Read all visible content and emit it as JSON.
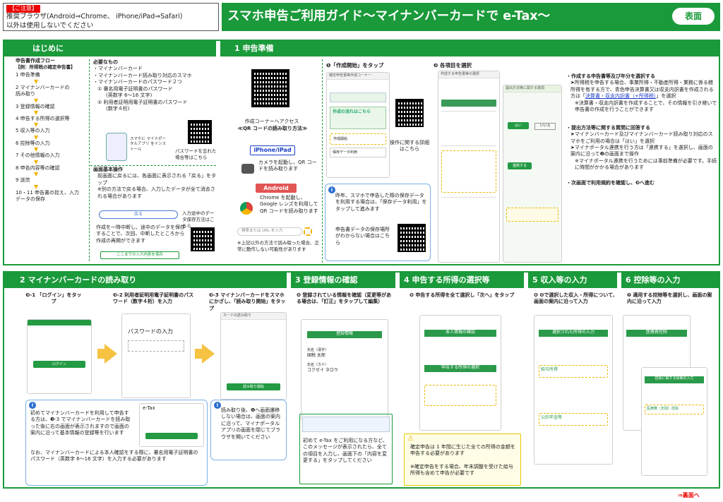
{
  "header": {
    "caution_label": "【ご注意】",
    "caution_line1": "推奨ブラウザ(Android⇒Chrome、 iPhone/iPad⇒Safari)",
    "caution_line2": "以外は使用しないでください",
    "title": "スマホ申告ご利用ガイド～マイナンバーカードで e-Tax～",
    "side_badge": "表面"
  },
  "intro": {
    "title": "はじめに",
    "flow_title": "申告書作成フロー",
    "flow_example": "【例：所得税の確定申告書】",
    "flow": [
      "1 申告準備",
      "2 マイナンバーカードの読み取り",
      "3 登録情報の確認",
      "4 申告する所得の選択等",
      "5 収入等の入力",
      "6 控除等の入力",
      "7 その他情報の入力",
      "8 申告内容等の確認",
      "9 送信",
      "10・11 申告書の控え、入力データの保存"
    ],
    "needs_title": "必要なもの",
    "needs": [
      "・マイナンバーカード",
      "・マイナンバーカード読み取り対応のスマホ",
      "・マイナンバーカードのパスワード２つ"
    ],
    "need1": "① 署名用電子証明書のパスワード",
    "need1b": "(英数字 6～16 文字)",
    "need2": "② 利用者証明用電子証明書のパスワード",
    "need2b": "(数字４桁)",
    "app_label": "スマホに マイナポータルアプリ をインストール",
    "pw_forgot": "パスワードを忘れた場合等はこちら",
    "basic_title": "画面基本操作",
    "basic1": "前画面に戻るには、各画面に表示される「戻る」をタップ",
    "basic2": "※別の方法で戻る場合、入力したデータが全て消去される場合があります",
    "back_btn": "戻る",
    "save_caption": "入力途中のデータ保存方法はこちら",
    "basic3": "作成を一時中断し、途中のデータを保存することで、次回、中断したところから作成の再開ができます",
    "save_btn": "ここまでの入力内容を保存"
  },
  "prep": {
    "title": "1 申告準備",
    "qr_caption1": "作成コーナーへアクセス",
    "qr_caption2": "≪QR コードの読み取り方法≫",
    "iphone_label": "iPhone/iPad",
    "iphone_text": "カメラを起動し、QR コードを読み取ります",
    "android_label": "Android",
    "android_text": "Chrome を起動し、Google レンズを利用して QR コードを読み取ります",
    "search_ph": "検索または URL を入力",
    "qr_note": "※上記以外の方法で読み取った場合、正常に動作しない可能性があります",
    "step1": "❶「作成開始」をタップ",
    "ph_title": "確定申告書等作成コーナー",
    "ph_item1": "作成の流れはこちら",
    "ph_item2": "作成開始",
    "ph_item3": "保存データ利用",
    "detail_caption": "操作に関する詳細はこちら",
    "save_info": "昨年、スマホで申告した際の保存データを利用する場合は、「保存データ利用」をタップして進みます",
    "save_location": "申告書データの保存場所がわからない場合はこちら",
    "step2": "❷ 各項目を選択",
    "ph2_title": "作成する申告書等の選択",
    "ph3_title": "提出方法等に関する質問",
    "yes": "はい",
    "no": "いいえ",
    "connect": "連携する",
    "b1_head": "・作成する申告書等及び年分を選択する",
    "b1_1": "➤所得税を申告する場合、事業所得・不動産所得・業務に係る雑所得を有する方で、青色申告決算書又は収支内訳書を作成される方は「",
    "b1_link": "決算書・収支内訳書（+所得税）",
    "b1_2": "」を選択",
    "b1_3": "※決算書・収支内訳書を作成することで、その情報を引き継いで申告書の作成を行うことができます",
    "b2_head": "・提出方法等に関する質問に回答する",
    "b2_1": "➤マイナンバーカード及びマイナンバーカード読み取り対応のスマホをご利用の場合は「はい」を選択",
    "b2_2": "➤マイナポータル連携を行う方は「連携する」を選択し、画面の案内に沿って❷の画面まで操作",
    "b2_3": "※マイナポータル連携を行うためには事前準備が必要です。手続に時間がかかる場合があります",
    "b3": "・次画面で利用規約を確認し、❸へ進む"
  },
  "card": {
    "title": "2 マイナンバーカードの読み取り",
    "s1": "❸-1 「ログイン」をタップ",
    "s2": "❸-2 利用者証明用電子証明書のパスワード（数字４桁）を入力",
    "s3": "❸-3 マイナンバーカードをスマホにかざし、「読み取り開始」をタップ",
    "login": "ログイン",
    "pw_input": "パスワードの入力",
    "read_title": "カードの読み取り",
    "read_btn": "読み取り開始",
    "info1": "初めてマイナンバーカードを利用して申告する方は、❸-3 でマイナンバーカードを読み取った後に右の画面が表示されますので画面の案内に沿って基本情報の登録等を行います",
    "info2": "なお、マイナンバーカードによる本人確認をする際に、署名用電子証明書のパスワード（英数字 6～16 文字）を入力する必要があります",
    "etax": "e-Tax",
    "info3": "読み取り後、❹へ画面遷移しない場合は、画面の案内に沿って、マイナポータルアプリの画面を閉じてブラウザを開いてください"
  },
  "reg": {
    "title": "3 登録情報の確認",
    "s4": "❹ 登録されている情報を確認（変更等がある場合は、「訂正」をタップして編集）",
    "reg_info": "登録情報",
    "name_label": "氏名（漢字）",
    "name": "国税 太郎",
    "kana_label": "氏名（カナ）",
    "kana": "コクゼイ タロウ",
    "info": "初めて e-Tax をご利用になる方など、このメッセージが表示されたら、全ての項目を入力し、画面下の「内容を変更する」をタップしてください"
  },
  "income": {
    "title": "4 申告する所得の選択等",
    "s5": "❺ 申告する所得を全て選択し「次へ」をタップ",
    "confirm": "本人情報の確認",
    "select": "申告する所得の選択",
    "warn1": "確定申告は 1 年間に生じた全ての所得の金額を申告する必要があります",
    "warn2": "※確定申告をする場合、年末調整を受けた給与所得も含めて申告が必要です"
  },
  "rev": {
    "title": "5 収入等の入力",
    "s6": "❻ ❺で選択した収入・所得について、画面の案内に沿って入力",
    "head": "選択された所得の入力",
    "salary": "給与所得",
    "pension": "公的年金等"
  },
  "ded": {
    "title": "6 控除等の入力",
    "s7": "❼ 適用する控除等を選択し、画面の案内に沿って入力",
    "head": "医療費控除",
    "head2": "控除に関する情報の入力",
    "item1": "医療費（年間）控除"
  },
  "footer": {
    "next": "⇒裏面へ"
  }
}
